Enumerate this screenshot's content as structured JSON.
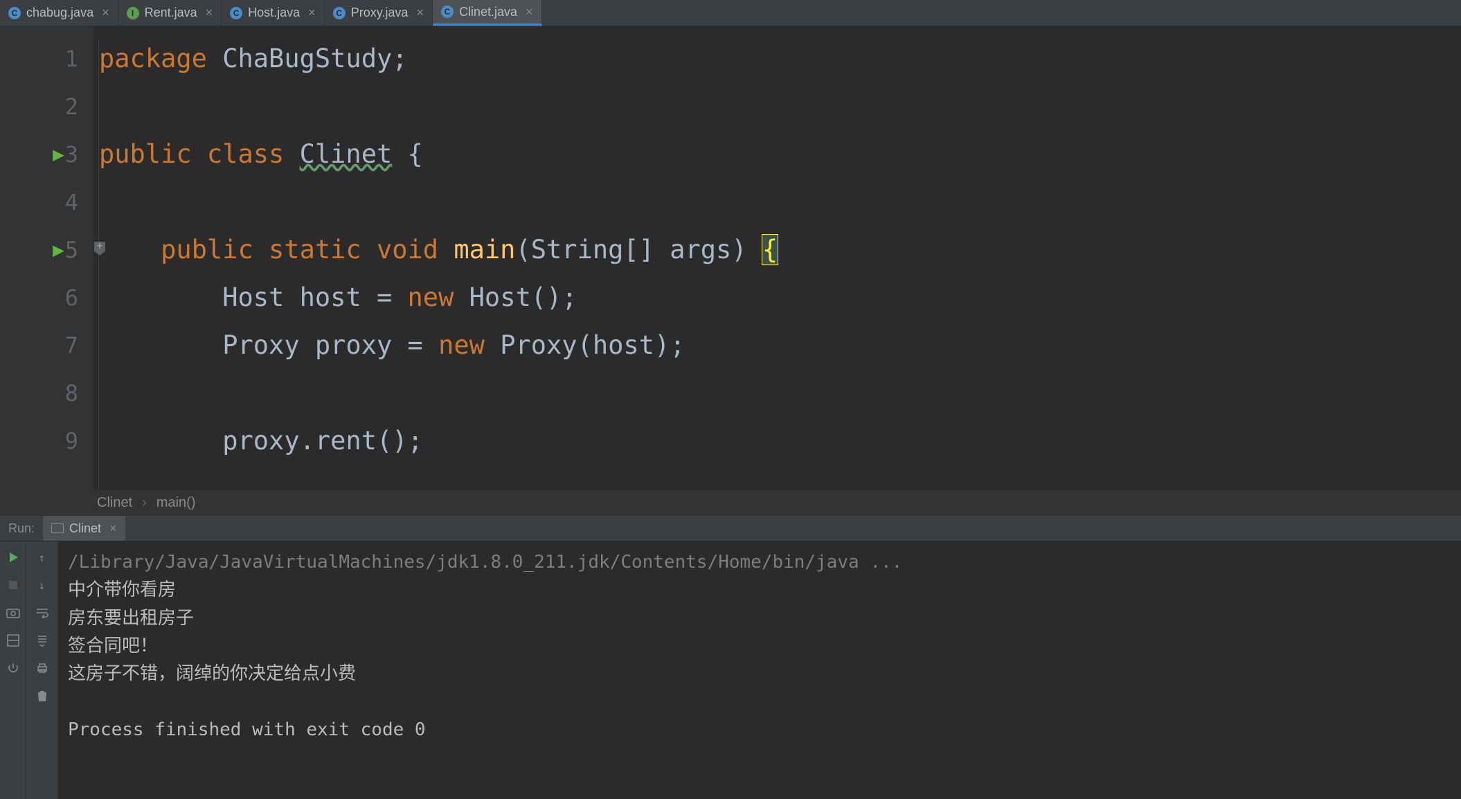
{
  "tabs": [
    {
      "label": "chabug.java",
      "icon_type": "class",
      "icon_letter": "C",
      "active": false
    },
    {
      "label": "Rent.java",
      "icon_type": "interface",
      "icon_letter": "I",
      "active": false
    },
    {
      "label": "Host.java",
      "icon_type": "class",
      "icon_letter": "C",
      "active": false
    },
    {
      "label": "Proxy.java",
      "icon_type": "class",
      "icon_letter": "C",
      "active": false
    },
    {
      "label": "Clinet.java",
      "icon_type": "class",
      "icon_letter": "C",
      "active": true
    }
  ],
  "editor": {
    "lines": [
      {
        "num": "1",
        "tokens": [
          {
            "t": "package ",
            "c": "kw"
          },
          {
            "t": "ChaBugStudy;",
            "c": "str-text"
          }
        ]
      },
      {
        "num": "2",
        "tokens": []
      },
      {
        "num": "3",
        "run": true,
        "tokens": [
          {
            "t": "public class ",
            "c": "kw"
          },
          {
            "t": "Clinet",
            "c": "str-text typo-underline"
          },
          {
            "t": " {",
            "c": "str-text"
          }
        ]
      },
      {
        "num": "4",
        "tokens": []
      },
      {
        "num": "5",
        "run": true,
        "fold": true,
        "indent": 1,
        "tokens": [
          {
            "t": "public static void ",
            "c": "kw"
          },
          {
            "t": "main",
            "c": "method-decl"
          },
          {
            "t": "(String[] args) ",
            "c": "str-text"
          },
          {
            "t": "{",
            "c": "brace-match"
          }
        ]
      },
      {
        "num": "6",
        "indent": 2,
        "tokens": [
          {
            "t": "Host host = ",
            "c": "str-text"
          },
          {
            "t": "new ",
            "c": "kw"
          },
          {
            "t": "Host();",
            "c": "str-text"
          }
        ]
      },
      {
        "num": "7",
        "indent": 2,
        "tokens": [
          {
            "t": "Proxy proxy = ",
            "c": "str-text"
          },
          {
            "t": "new ",
            "c": "kw"
          },
          {
            "t": "Proxy(host);",
            "c": "str-text"
          }
        ]
      },
      {
        "num": "8",
        "tokens": []
      },
      {
        "num": "9",
        "indent": 2,
        "tokens": [
          {
            "t": "proxy.rent();",
            "c": "str-text"
          }
        ]
      }
    ]
  },
  "breadcrumb": {
    "class": "Clinet",
    "method": "main()"
  },
  "run_panel": {
    "label": "Run:",
    "tab": "Clinet"
  },
  "console": {
    "lines": [
      {
        "text": "/Library/Java/JavaVirtualMachines/jdk1.8.0_211.jdk/Contents/Home/bin/java ...",
        "cls": "cmd"
      },
      {
        "text": "中介带你看房",
        "cls": ""
      },
      {
        "text": "房东要出租房子",
        "cls": ""
      },
      {
        "text": "签合同吧！",
        "cls": ""
      },
      {
        "text": "这房子不错，阔绰的你决定给点小费",
        "cls": ""
      },
      {
        "text": "",
        "cls": ""
      },
      {
        "text": "Process finished with exit code 0",
        "cls": ""
      }
    ]
  }
}
